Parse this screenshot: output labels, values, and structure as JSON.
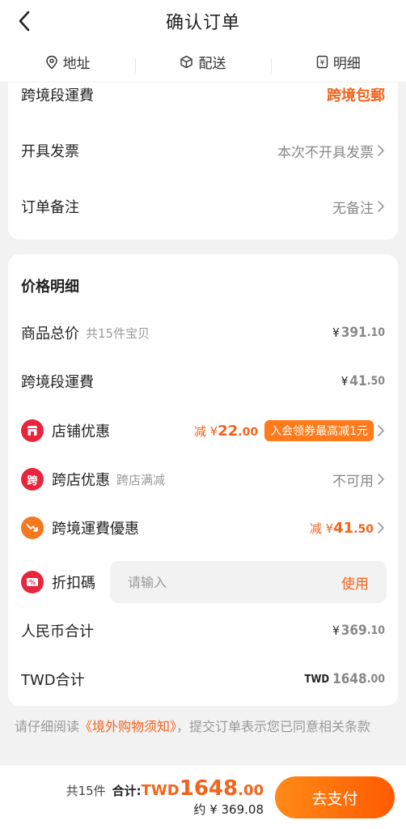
{
  "header": {
    "title": "确认订单"
  },
  "tabs": [
    {
      "label": "地址",
      "icon": "location-pin-icon"
    },
    {
      "label": "配送",
      "icon": "package-icon"
    },
    {
      "label": "明细",
      "icon": "receipt-icon"
    }
  ],
  "order_options": {
    "shipping_label": "跨境段運費",
    "shipping_value": "跨境包郵",
    "invoice_label": "开具发票",
    "invoice_value": "本次不开具发票",
    "remark_label": "订单备注",
    "remark_value": "无备注"
  },
  "price_detail": {
    "title": "价格明细",
    "goods_total_label": "商品总价",
    "goods_total_sub": "共15件宝贝",
    "goods_total_currency": "¥",
    "goods_total_int": "391",
    "goods_total_dec": ".10",
    "shipping_label": "跨境段運費",
    "shipping_currency": "¥",
    "shipping_int": "41",
    "shipping_dec": ".50",
    "store_discount_label": "店铺优惠",
    "store_discount_prefix": "减 ¥",
    "store_discount_int": "22",
    "store_discount_dec": ".00",
    "store_discount_badge": "入会领券最高减1元",
    "cross_store_label": "跨店优惠",
    "cross_store_sub": "跨店满减",
    "cross_store_value": "不可用",
    "cross_store_icon_text": "跨",
    "shipping_discount_label": "跨境運費優惠",
    "shipping_discount_prefix": "减 ¥",
    "shipping_discount_int": "41",
    "shipping_discount_dec": ".50",
    "coupon_label": "折扣碼",
    "coupon_placeholder": "请输入",
    "coupon_use": "使用",
    "rmb_total_label": "人民币合计",
    "rmb_total_currency": "¥",
    "rmb_total_int": "369",
    "rmb_total_dec": ".10",
    "twd_total_label": "TWD合计",
    "twd_total_currency": "TWD",
    "twd_total_int": "1648",
    "twd_total_dec": ".00"
  },
  "notice": {
    "prefix": "请仔细阅读",
    "link": "《境外购物须知》",
    "suffix": "，提交订单表示您已同意相关条款"
  },
  "footer": {
    "count": "共15件",
    "total_label": "合计:",
    "currency": "TWD",
    "total_int": "1648",
    "total_dec": ".00",
    "approx": "约 ¥ 369.08",
    "pay_button": "去支付"
  },
  "colors": {
    "accent": "#f2631c",
    "button_gradient_start": "#ff8a18",
    "button_gradient_end": "#ff5a00",
    "store_icon": "#e8253c",
    "cross_icon": "#e8253c",
    "shipping_icon": "#f5781e",
    "coupon_icon": "#e8253c"
  }
}
